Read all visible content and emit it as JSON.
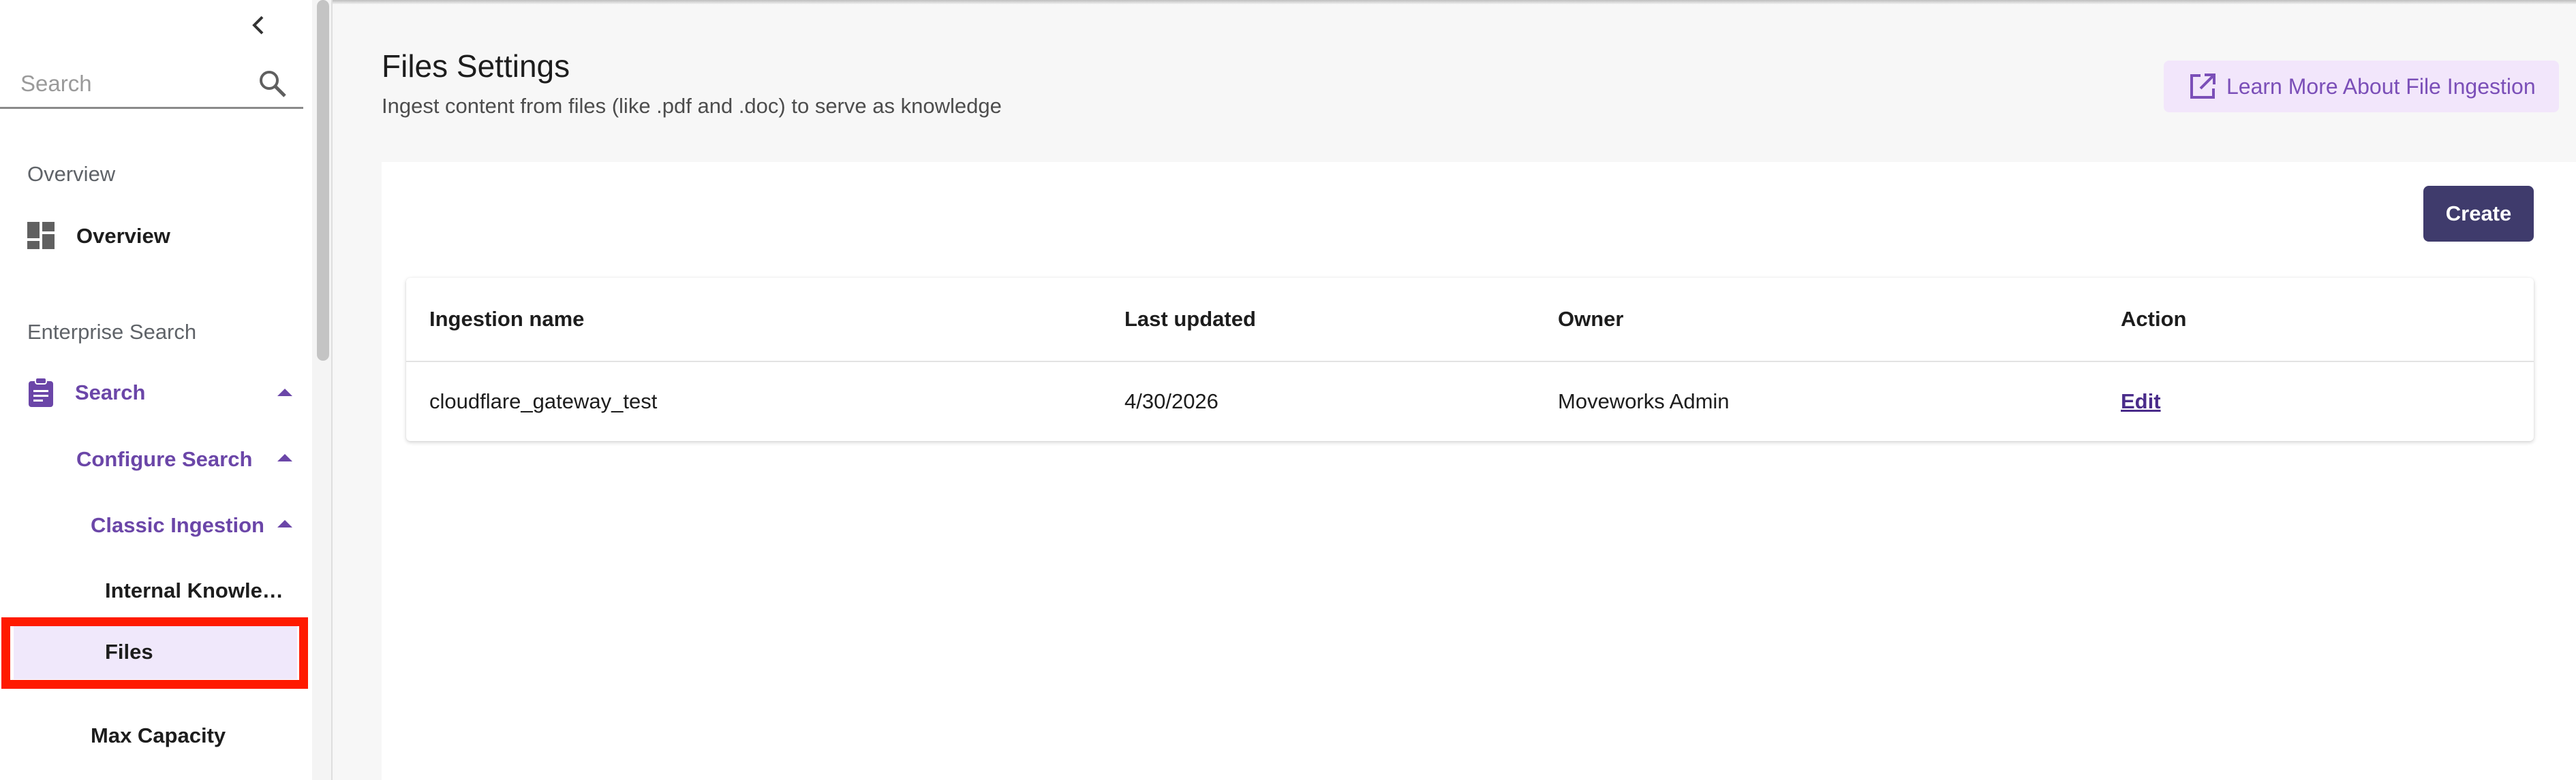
{
  "sidebar": {
    "search": {
      "placeholder": "Search",
      "value": ""
    },
    "sections": [
      {
        "header": "Overview"
      },
      {
        "header": "Enterprise Search"
      }
    ],
    "items": {
      "overview": "Overview",
      "search": "Search",
      "configure_search": "Configure Search",
      "classic_ingestion": "Classic Ingestion",
      "internal_knowledge": "Internal Knowle…",
      "files": "Files",
      "max_capacity": "Max Capacity"
    },
    "selected_item": "Files"
  },
  "header": {
    "title": "Files Settings",
    "subtitle": "Ingest content from files (like .pdf and .doc) to serve as knowledge",
    "learn_more_label": "Learn More About File Ingestion"
  },
  "toolbar": {
    "create_label": "Create"
  },
  "table": {
    "columns": [
      "Ingestion name",
      "Last updated",
      "Owner",
      "Action"
    ],
    "rows": [
      {
        "name": "cloudflare_gateway_test",
        "updated": "4/30/2026",
        "owner": "Moveworks Admin",
        "action": "Edit"
      }
    ]
  },
  "colors": {
    "accent_purple": "#6b46a8",
    "primary_button": "#3f3b6c",
    "learn_more_bg": "#f2e6fb",
    "selected_bg": "#f0e8fb",
    "highlight_red": "#ff1a00"
  },
  "icons": {
    "collapse": "chevron-left-icon",
    "search": "search-icon",
    "overview": "dashboard-icon",
    "search_nav": "clipboard-icon",
    "learn_more": "open-in-new-icon"
  }
}
